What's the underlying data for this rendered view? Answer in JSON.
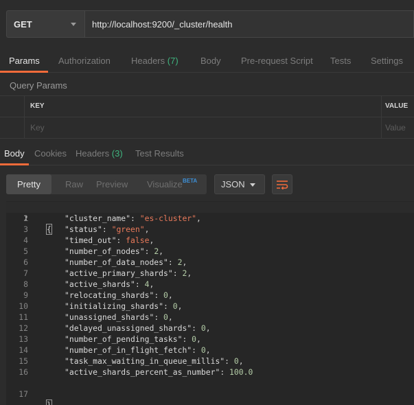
{
  "request": {
    "method": "GET",
    "url": "http://localhost:9200/_cluster/health"
  },
  "request_tabs": {
    "params": "Params",
    "authorization": "Authorization",
    "headers": "Headers",
    "headers_count": "(7)",
    "body": "Body",
    "pre_request_script": "Pre-request Script",
    "tests": "Tests",
    "settings": "Settings"
  },
  "query_params": {
    "title": "Query Params",
    "key_header": "KEY",
    "value_header": "VALUE",
    "key_placeholder": "Key",
    "value_placeholder": "Value"
  },
  "response_tabs": {
    "body": "Body",
    "cookies": "Cookies",
    "headers": "Headers",
    "headers_count": "(3)",
    "test_results": "Test Results"
  },
  "toolbar": {
    "pretty": "Pretty",
    "raw": "Raw",
    "preview": "Preview",
    "visualize": "Visualize",
    "beta": "BETA",
    "format": "JSON",
    "wrap_icon": "wrap-lines-icon"
  },
  "response_body": {
    "line_numbers": [
      "1",
      "2",
      "3",
      "4",
      "5",
      "6",
      "7",
      "8",
      "9",
      "10",
      "11",
      "12",
      "13",
      "14",
      "15",
      "16",
      "17"
    ],
    "open_brace": "{",
    "close_brace": "}",
    "fields": [
      {
        "key": "\"cluster_name\"",
        "value": "\"es-cluster\"",
        "kind": "s",
        "comma": ","
      },
      {
        "key": "\"status\"",
        "value": "\"green\"",
        "kind": "s",
        "comma": ","
      },
      {
        "key": "\"timed_out\"",
        "value": "false",
        "kind": "b",
        "comma": ","
      },
      {
        "key": "\"number_of_nodes\"",
        "value": "2",
        "kind": "n",
        "comma": ","
      },
      {
        "key": "\"number_of_data_nodes\"",
        "value": "2",
        "kind": "n",
        "comma": ","
      },
      {
        "key": "\"active_primary_shards\"",
        "value": "2",
        "kind": "n",
        "comma": ","
      },
      {
        "key": "\"active_shards\"",
        "value": "4",
        "kind": "n",
        "comma": ","
      },
      {
        "key": "\"relocating_shards\"",
        "value": "0",
        "kind": "n",
        "comma": ","
      },
      {
        "key": "\"initializing_shards\"",
        "value": "0",
        "kind": "n",
        "comma": ","
      },
      {
        "key": "\"unassigned_shards\"",
        "value": "0",
        "kind": "n",
        "comma": ","
      },
      {
        "key": "\"delayed_unassigned_shards\"",
        "value": "0",
        "kind": "n",
        "comma": ","
      },
      {
        "key": "\"number_of_pending_tasks\"",
        "value": "0",
        "kind": "n",
        "comma": ","
      },
      {
        "key": "\"number_of_in_flight_fetch\"",
        "value": "0",
        "kind": "n",
        "comma": ","
      },
      {
        "key": "\"task_max_waiting_in_queue_millis\"",
        "value": "0",
        "kind": "n",
        "comma": ","
      },
      {
        "key": "\"active_shards_percent_as_number\"",
        "value": "100.0",
        "kind": "n",
        "comma": ""
      }
    ]
  }
}
